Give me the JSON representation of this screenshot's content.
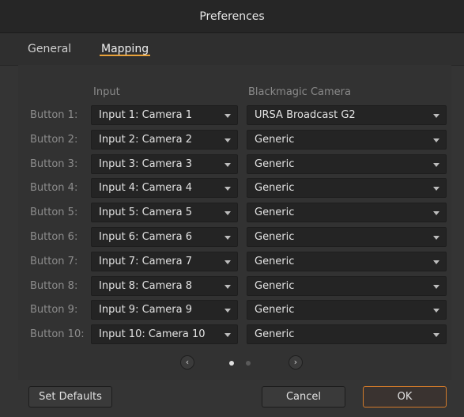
{
  "window": {
    "title": "Preferences"
  },
  "tabs": [
    {
      "label": "General",
      "active": false
    },
    {
      "label": "Mapping",
      "active": true
    }
  ],
  "colors": {
    "accent": "#e8a23a",
    "ok_border": "#d27a2a"
  },
  "columns": {
    "input": "Input",
    "camera": "Blackmagic Camera"
  },
  "rows": [
    {
      "label": "Button 1:",
      "input": "Input 1: Camera 1",
      "camera": "URSA Broadcast G2"
    },
    {
      "label": "Button 2:",
      "input": "Input 2: Camera 2",
      "camera": "Generic"
    },
    {
      "label": "Button 3:",
      "input": "Input 3: Camera 3",
      "camera": "Generic"
    },
    {
      "label": "Button 4:",
      "input": "Input 4: Camera 4",
      "camera": "Generic"
    },
    {
      "label": "Button 5:",
      "input": "Input 5: Camera 5",
      "camera": "Generic"
    },
    {
      "label": "Button 6:",
      "input": "Input 6: Camera 6",
      "camera": "Generic"
    },
    {
      "label": "Button 7:",
      "input": "Input 7: Camera 7",
      "camera": "Generic"
    },
    {
      "label": "Button 8:",
      "input": "Input 8: Camera 8",
      "camera": "Generic"
    },
    {
      "label": "Button 9:",
      "input": "Input 9: Camera 9",
      "camera": "Generic"
    },
    {
      "label": "Button 10:",
      "input": "Input 10: Camera 10",
      "camera": "Generic"
    }
  ],
  "pager": {
    "prev_icon": "chevron-left-icon",
    "next_icon": "chevron-right-icon",
    "pages": 2,
    "current": 1
  },
  "footer": {
    "set_defaults": "Set Defaults",
    "cancel": "Cancel",
    "ok": "OK"
  }
}
